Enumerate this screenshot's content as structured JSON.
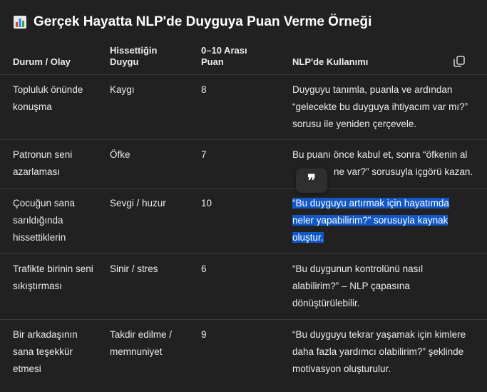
{
  "heading": {
    "title": "Gerçek Hayatta NLP'de Duyguya Puan Verme Örneği",
    "icon": "bar-chart-emoji-icon"
  },
  "table": {
    "headers": [
      "Durum / Olay",
      "Hissettiğin Duygu",
      "0–10 Arası Puan",
      "NLP'de Kullanımı"
    ],
    "rows": [
      {
        "event": "Topluluk önünde konuşma",
        "emotion": "Kaygı",
        "score": "8",
        "usage": "Duyguyu tanımla, puanla ve ardından “gelecekte bu duyguya ihtiyacım var mı?” sorusu ile yeniden çerçevele."
      },
      {
        "event": "Patronun seni azarlaması",
        "emotion": "Öfke",
        "score": "7",
        "usage_part1": "Bu puanı önce kabul et, sonra “öfkenin al",
        "usage_part2": "ne var?” sorusuyla içgörü kazan."
      },
      {
        "event": "Çocuğun sana sarıldığında hissettiklerin",
        "emotion": "Sevgi / huzur",
        "score": "10",
        "usage": "“Bu duyguyu artırmak için hayatımda neler yapabilirim?” sorusuyla kaynak oluştur."
      },
      {
        "event": "Trafikte birinin seni sıkıştırması",
        "emotion": "Sinir / stres",
        "score": "6",
        "usage": "“Bu duygunun kontrolünü nasıl alabilirim?” – NLP çapasına dönüştürülebilir."
      },
      {
        "event": "Bir arkadaşının sana teşekkür etmesi",
        "emotion": "Takdir edilme / memnuniyet",
        "score": "9",
        "usage": "“Bu duyguyu tekrar yaşamak için kimlere daha fazla yardımcı olabilirim?” şeklinde motivasyon oluşturulur."
      }
    ]
  },
  "selection_popup": {
    "glyph": "❞",
    "icon": "quote-icon"
  },
  "colors": {
    "background": "#212121",
    "text": "#ececec",
    "selection": "#1158c7",
    "divider": "#3a3a3a"
  }
}
